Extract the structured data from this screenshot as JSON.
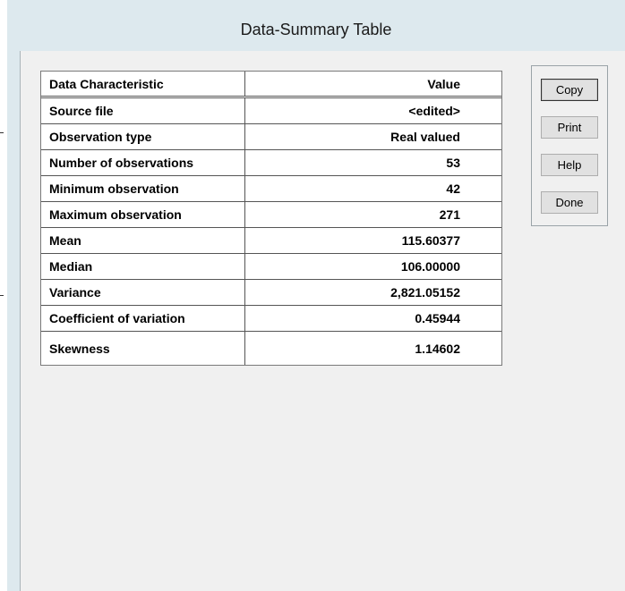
{
  "window": {
    "title": "Data-Summary Table"
  },
  "table": {
    "header": {
      "characteristic": "Data Characteristic",
      "value": "Value"
    },
    "rows": [
      {
        "characteristic": "Source file",
        "value": "<edited>"
      },
      {
        "characteristic": "Observation type",
        "value": "Real valued"
      },
      {
        "characteristic": "Number of observations",
        "value": "53"
      },
      {
        "characteristic": "Minimum observation",
        "value": "42"
      },
      {
        "characteristic": "Maximum observation",
        "value": "271"
      },
      {
        "characteristic": "Mean",
        "value": "115.60377"
      },
      {
        "characteristic": "Median",
        "value": "106.00000"
      },
      {
        "characteristic": "Variance",
        "value": "2,821.05152"
      },
      {
        "characteristic": "Coefficient of variation",
        "value": "0.45944"
      },
      {
        "characteristic": "Skewness",
        "value": "1.14602"
      }
    ]
  },
  "buttons": {
    "copy": "Copy",
    "print": "Print",
    "help": "Help",
    "done": "Done"
  }
}
